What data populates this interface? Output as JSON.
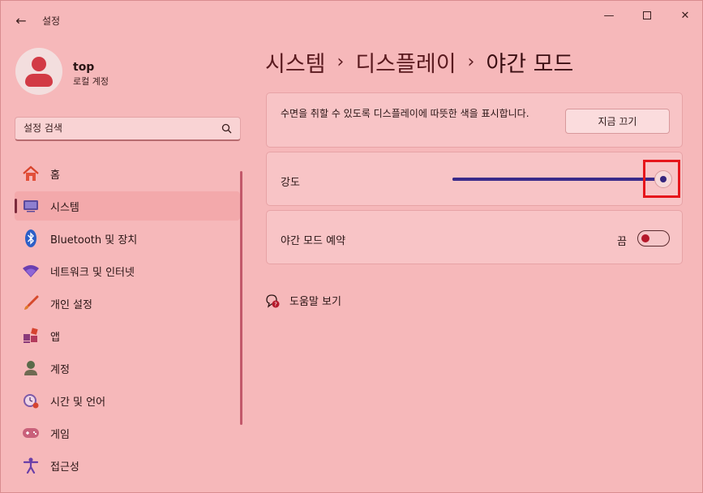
{
  "window": {
    "title": "설정",
    "back_glyph": "←",
    "minimize_glyph": "—",
    "close_glyph": "✕"
  },
  "profile": {
    "name": "top",
    "account_type": "로컬 계정"
  },
  "search": {
    "placeholder": "설정 검색"
  },
  "sidebar": {
    "items": [
      {
        "label": "홈",
        "icon": "home-icon",
        "active": false
      },
      {
        "label": "시스템",
        "icon": "system-icon",
        "active": true
      },
      {
        "label": "Bluetooth 및 장치",
        "icon": "bluetooth-icon",
        "active": false
      },
      {
        "label": "네트워크 및 인터넷",
        "icon": "wifi-icon",
        "active": false
      },
      {
        "label": "개인 설정",
        "icon": "brush-icon",
        "active": false
      },
      {
        "label": "앱",
        "icon": "apps-icon",
        "active": false
      },
      {
        "label": "계정",
        "icon": "account-icon",
        "active": false
      },
      {
        "label": "시간 및 언어",
        "icon": "time-language-icon",
        "active": false
      },
      {
        "label": "게임",
        "icon": "gamepad-icon",
        "active": false
      },
      {
        "label": "접근성",
        "icon": "accessibility-icon",
        "active": false
      }
    ]
  },
  "breadcrumb": {
    "items": [
      "시스템",
      "디스플레이",
      "야간 모드"
    ],
    "separator": "›"
  },
  "main": {
    "description": "수면을 취할 수 있도록 디스플레이에 따뜻한 색을 표시합니다.",
    "turn_off_button": "지금 끄기",
    "strength_label": "강도",
    "strength_value": 100,
    "schedule_label": "야간 모드 예약",
    "schedule_state": "끔",
    "schedule_on": false,
    "help_link": "도움말 보기"
  },
  "colors": {
    "background": "#f6b8ba",
    "accent": "#35257d",
    "highlight": "#e6151b"
  }
}
